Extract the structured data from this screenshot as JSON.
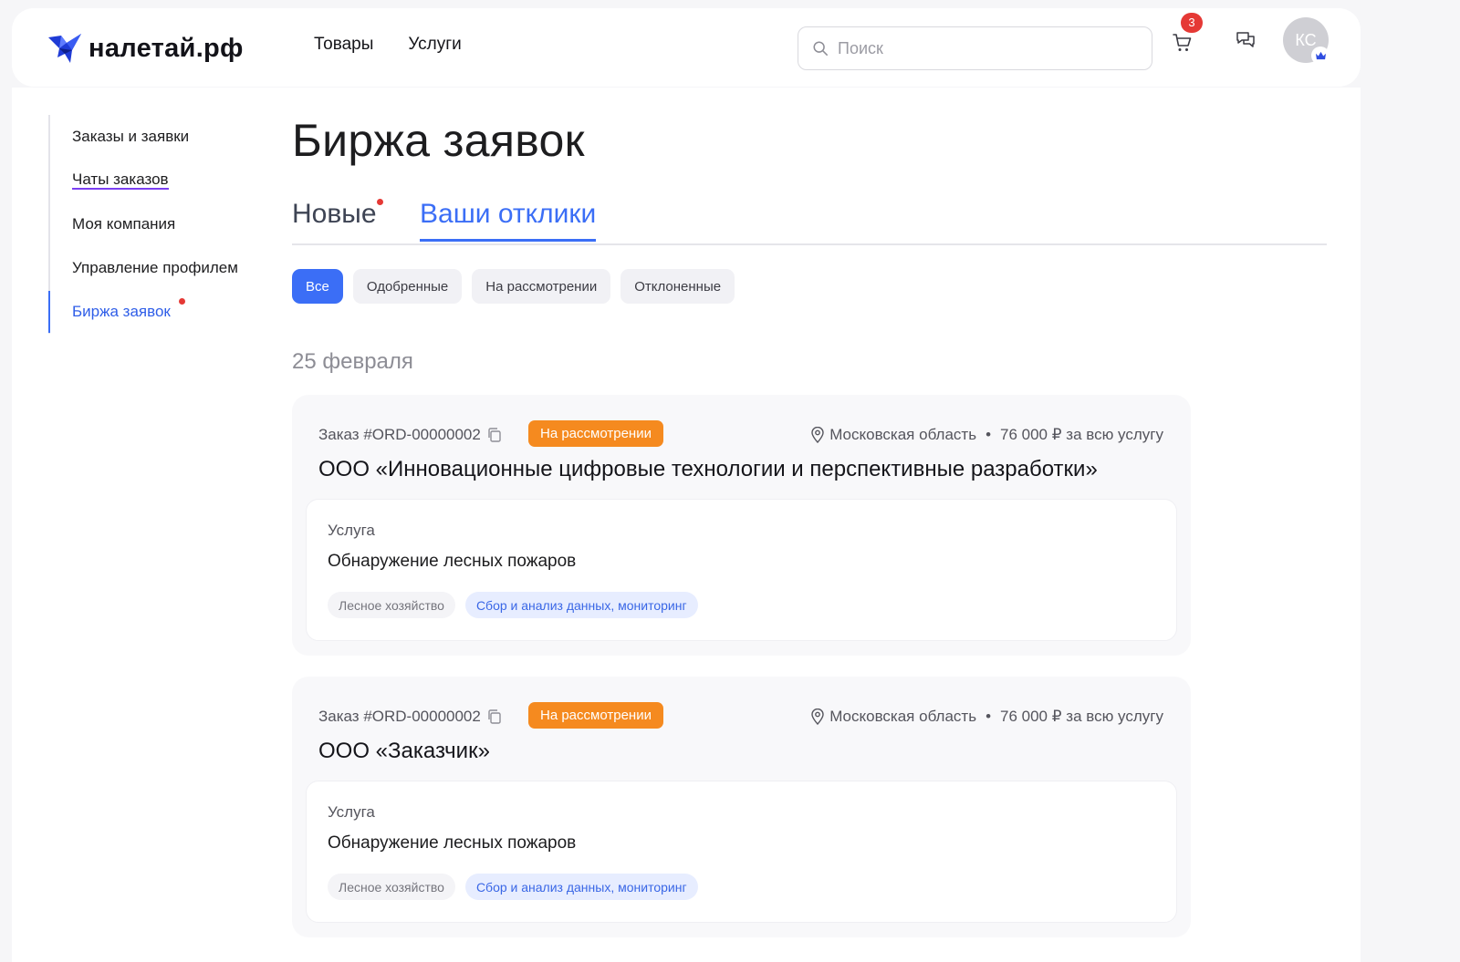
{
  "header": {
    "logo_text": "налетай.рф",
    "nav": [
      "Товары",
      "Услуги"
    ],
    "search_placeholder": "Поиск",
    "cart_count": "3",
    "avatar_initials": "КС"
  },
  "sidebar": {
    "items": [
      {
        "label": "Заказы и заявки"
      },
      {
        "label": "Чаты заказов"
      },
      {
        "label": "Моя компания"
      },
      {
        "label": "Управление профилем"
      },
      {
        "label": "Биржа заявок"
      }
    ]
  },
  "page": {
    "title": "Биржа заявок",
    "tabs": [
      "Новые",
      "Ваши отклики"
    ],
    "filters": [
      "Все",
      "Одобренные",
      "На рассмотрении",
      "Отклоненные"
    ],
    "date_heading": "25 февраля"
  },
  "orders": [
    {
      "order_number": "Заказ #ORD-00000002",
      "status": "На рассмотрении",
      "region": "Московская область",
      "separator": "•",
      "price": "76 000 ₽ за всю услугу",
      "company": "ООО «Инновационные цифровые технологии и перспективные разработки»",
      "service_label": "Услуга",
      "service_name": "Обнаружение лесных пожаров",
      "tags": [
        "Лесное хозяйство",
        "Сбор и анализ данных, мониторинг"
      ]
    },
    {
      "order_number": "Заказ #ORD-00000002",
      "status": "На рассмотрении",
      "region": "Московская область",
      "separator": "•",
      "price": "76 000 ₽ за всю услугу",
      "company": "ООО «Заказчик»",
      "service_label": "Услуга",
      "service_name": "Обнаружение лесных пожаров",
      "tags": [
        "Лесное хозяйство",
        "Сбор и анализ данных, мониторинг"
      ]
    }
  ],
  "colors": {
    "accent": "#3b6ef6",
    "status_review": "#f58a1f",
    "notification": "#e53935"
  },
  "icons": [
    "logo-icon",
    "search-icon",
    "cart-icon",
    "chat-icon",
    "crown-icon",
    "copy-icon",
    "location-pin-icon"
  ]
}
